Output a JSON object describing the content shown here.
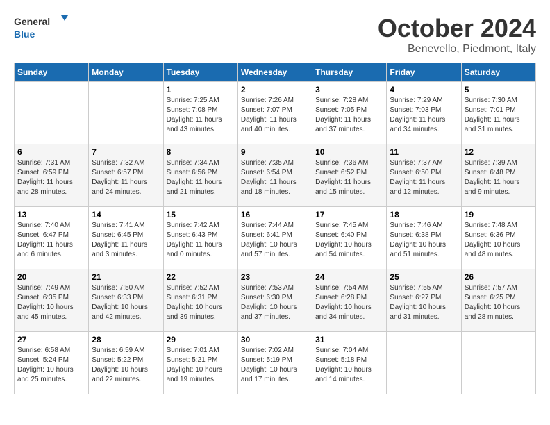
{
  "logo": {
    "text_general": "General",
    "text_blue": "Blue"
  },
  "title": "October 2024",
  "location": "Benevello, Piedmont, Italy",
  "days_of_week": [
    "Sunday",
    "Monday",
    "Tuesday",
    "Wednesday",
    "Thursday",
    "Friday",
    "Saturday"
  ],
  "weeks": [
    [
      {
        "day": "",
        "info": ""
      },
      {
        "day": "",
        "info": ""
      },
      {
        "day": "1",
        "info": "Sunrise: 7:25 AM\nSunset: 7:08 PM\nDaylight: 11 hours and 43 minutes."
      },
      {
        "day": "2",
        "info": "Sunrise: 7:26 AM\nSunset: 7:07 PM\nDaylight: 11 hours and 40 minutes."
      },
      {
        "day": "3",
        "info": "Sunrise: 7:28 AM\nSunset: 7:05 PM\nDaylight: 11 hours and 37 minutes."
      },
      {
        "day": "4",
        "info": "Sunrise: 7:29 AM\nSunset: 7:03 PM\nDaylight: 11 hours and 34 minutes."
      },
      {
        "day": "5",
        "info": "Sunrise: 7:30 AM\nSunset: 7:01 PM\nDaylight: 11 hours and 31 minutes."
      }
    ],
    [
      {
        "day": "6",
        "info": "Sunrise: 7:31 AM\nSunset: 6:59 PM\nDaylight: 11 hours and 28 minutes."
      },
      {
        "day": "7",
        "info": "Sunrise: 7:32 AM\nSunset: 6:57 PM\nDaylight: 11 hours and 24 minutes."
      },
      {
        "day": "8",
        "info": "Sunrise: 7:34 AM\nSunset: 6:56 PM\nDaylight: 11 hours and 21 minutes."
      },
      {
        "day": "9",
        "info": "Sunrise: 7:35 AM\nSunset: 6:54 PM\nDaylight: 11 hours and 18 minutes."
      },
      {
        "day": "10",
        "info": "Sunrise: 7:36 AM\nSunset: 6:52 PM\nDaylight: 11 hours and 15 minutes."
      },
      {
        "day": "11",
        "info": "Sunrise: 7:37 AM\nSunset: 6:50 PM\nDaylight: 11 hours and 12 minutes."
      },
      {
        "day": "12",
        "info": "Sunrise: 7:39 AM\nSunset: 6:48 PM\nDaylight: 11 hours and 9 minutes."
      }
    ],
    [
      {
        "day": "13",
        "info": "Sunrise: 7:40 AM\nSunset: 6:47 PM\nDaylight: 11 hours and 6 minutes."
      },
      {
        "day": "14",
        "info": "Sunrise: 7:41 AM\nSunset: 6:45 PM\nDaylight: 11 hours and 3 minutes."
      },
      {
        "day": "15",
        "info": "Sunrise: 7:42 AM\nSunset: 6:43 PM\nDaylight: 11 hours and 0 minutes."
      },
      {
        "day": "16",
        "info": "Sunrise: 7:44 AM\nSunset: 6:41 PM\nDaylight: 10 hours and 57 minutes."
      },
      {
        "day": "17",
        "info": "Sunrise: 7:45 AM\nSunset: 6:40 PM\nDaylight: 10 hours and 54 minutes."
      },
      {
        "day": "18",
        "info": "Sunrise: 7:46 AM\nSunset: 6:38 PM\nDaylight: 10 hours and 51 minutes."
      },
      {
        "day": "19",
        "info": "Sunrise: 7:48 AM\nSunset: 6:36 PM\nDaylight: 10 hours and 48 minutes."
      }
    ],
    [
      {
        "day": "20",
        "info": "Sunrise: 7:49 AM\nSunset: 6:35 PM\nDaylight: 10 hours and 45 minutes."
      },
      {
        "day": "21",
        "info": "Sunrise: 7:50 AM\nSunset: 6:33 PM\nDaylight: 10 hours and 42 minutes."
      },
      {
        "day": "22",
        "info": "Sunrise: 7:52 AM\nSunset: 6:31 PM\nDaylight: 10 hours and 39 minutes."
      },
      {
        "day": "23",
        "info": "Sunrise: 7:53 AM\nSunset: 6:30 PM\nDaylight: 10 hours and 37 minutes."
      },
      {
        "day": "24",
        "info": "Sunrise: 7:54 AM\nSunset: 6:28 PM\nDaylight: 10 hours and 34 minutes."
      },
      {
        "day": "25",
        "info": "Sunrise: 7:55 AM\nSunset: 6:27 PM\nDaylight: 10 hours and 31 minutes."
      },
      {
        "day": "26",
        "info": "Sunrise: 7:57 AM\nSunset: 6:25 PM\nDaylight: 10 hours and 28 minutes."
      }
    ],
    [
      {
        "day": "27",
        "info": "Sunrise: 6:58 AM\nSunset: 5:24 PM\nDaylight: 10 hours and 25 minutes."
      },
      {
        "day": "28",
        "info": "Sunrise: 6:59 AM\nSunset: 5:22 PM\nDaylight: 10 hours and 22 minutes."
      },
      {
        "day": "29",
        "info": "Sunrise: 7:01 AM\nSunset: 5:21 PM\nDaylight: 10 hours and 19 minutes."
      },
      {
        "day": "30",
        "info": "Sunrise: 7:02 AM\nSunset: 5:19 PM\nDaylight: 10 hours and 17 minutes."
      },
      {
        "day": "31",
        "info": "Sunrise: 7:04 AM\nSunset: 5:18 PM\nDaylight: 10 hours and 14 minutes."
      },
      {
        "day": "",
        "info": ""
      },
      {
        "day": "",
        "info": ""
      }
    ]
  ]
}
